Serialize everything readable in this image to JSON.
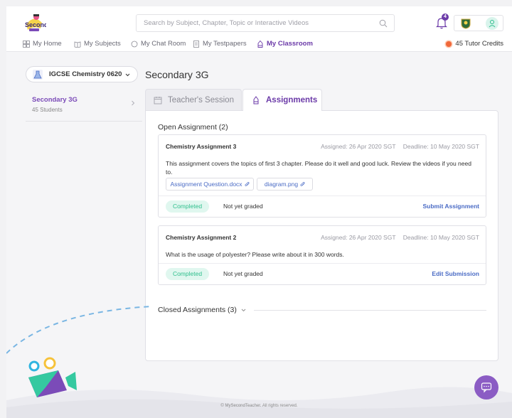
{
  "header": {
    "search_placeholder": "Search by Subject, Chapter, Topic or Interactive Videos",
    "notification_count": "4",
    "logo_icon": "my-second-teacher-logo",
    "profile_icon": "school-crest-icon"
  },
  "nav": {
    "items": [
      {
        "label": "My Home",
        "icon": "home-icon"
      },
      {
        "label": "My Subjects",
        "icon": "book-icon"
      },
      {
        "label": "My Chat Room",
        "icon": "chat-icon"
      },
      {
        "label": "My Testpapers",
        "icon": "testpaper-icon"
      },
      {
        "label": "My Classroom",
        "icon": "classroom-icon",
        "active": true
      }
    ],
    "credits": "45 Tutor Credits"
  },
  "sidebar": {
    "course": "IGCSE Chemistry 0620",
    "classes": [
      {
        "name": "Secondary 3G",
        "students": "45 Students"
      }
    ]
  },
  "main": {
    "title": "Secondary 3G",
    "tabs": {
      "teacher": "Teacher's Session",
      "assignments": "Assignments"
    },
    "open_label": "Open Assignment (2)",
    "assignments": [
      {
        "title": "Chemistry Assignment 3",
        "assigned": "Assigned: 26 Apr 2020 SGT",
        "deadline": "Deadline: 10 May 2020 SGT",
        "description": "This assignment covers the topics of first 3 chapter. Please do it well and good luck. Review the videos if you need to.",
        "attachments": [
          "Assignment Question.docx",
          "diagram.png"
        ],
        "status": "Completed",
        "grade": "Not yet graded",
        "action": "Submit Assignment"
      },
      {
        "title": "Chemistry Assignment 2",
        "assigned": "Assigned: 26 Apr 2020 SGT",
        "deadline": "Deadline: 10 May 2020 SGT",
        "description": "What is the usage of polyester? Please write about it in 300 words.",
        "status": "Completed",
        "grade": "Not yet graded",
        "action": "Edit Submission"
      }
    ],
    "closed_label": "Closed Assignments (3)"
  },
  "footer": {
    "copyright": "© MySecondTeacher. All rights reserved."
  },
  "colors": {
    "accent": "#6b3aa8",
    "link": "#4a6bc5",
    "completed": "#2fbf8d",
    "credit_coin": "#f0683a"
  }
}
